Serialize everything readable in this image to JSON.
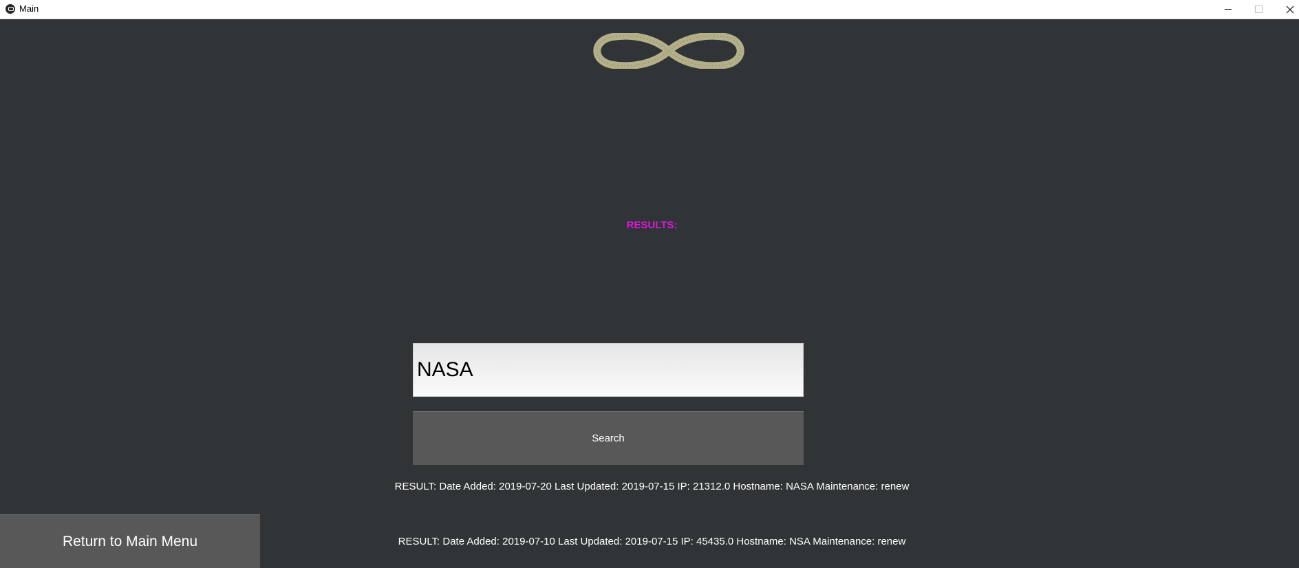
{
  "window": {
    "title": "Main"
  },
  "colors": {
    "background": "#303436",
    "results_label": "#d61ad9",
    "button": "#585858",
    "logo": "#b3b089"
  },
  "logo": {
    "icon": "infinity-logo-icon"
  },
  "results": {
    "label": "RESULTS:",
    "items": [
      "RESULT: Date Added: 2019-07-20 Last Updated: 2019-07-15 IP: 21312.0 Hostname: NASA Maintenance: renew",
      "RESULT: Date Added: 2019-07-10 Last Updated: 2019-07-15 IP: 45435.0 Hostname: NSA Maintenance: renew"
    ]
  },
  "search": {
    "value": "NASA",
    "button_label": "Search"
  },
  "nav": {
    "return_label": "Return to Main Menu"
  }
}
